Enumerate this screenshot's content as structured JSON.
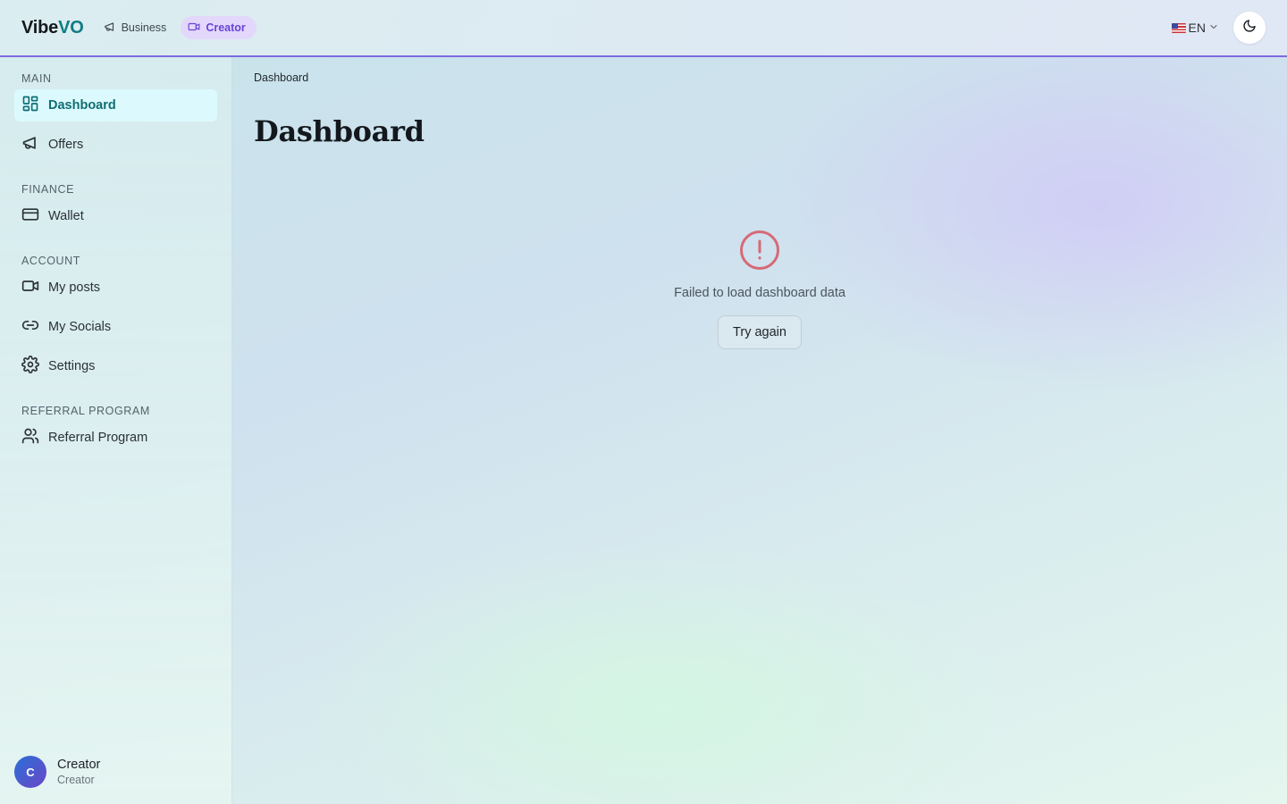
{
  "header": {
    "brand_primary": "Vibe",
    "brand_accent": "VO",
    "modes": [
      {
        "label": "Business",
        "icon": "megaphone-icon",
        "active": false
      },
      {
        "label": "Creator",
        "icon": "video-icon",
        "active": true
      }
    ],
    "language": "EN",
    "language_flag": "us-flag-icon",
    "theme_toggle_icon": "moon-icon"
  },
  "sidebar": {
    "sections": [
      {
        "label": "MAIN",
        "items": [
          {
            "label": "Dashboard",
            "icon": "dashboard-grid-icon",
            "active": true
          },
          {
            "label": "Offers",
            "icon": "megaphone-icon",
            "active": false
          }
        ]
      },
      {
        "label": "FINANCE",
        "items": [
          {
            "label": "Wallet",
            "icon": "credit-card-icon",
            "active": false
          }
        ]
      },
      {
        "label": "ACCOUNT",
        "items": [
          {
            "label": "My posts",
            "icon": "video-icon",
            "active": false
          },
          {
            "label": "My Socials",
            "icon": "link-icon",
            "active": false
          },
          {
            "label": "Settings",
            "icon": "gear-icon",
            "active": false
          }
        ]
      },
      {
        "label": "REFERRAL PROGRAM",
        "items": [
          {
            "label": "Referral Program",
            "icon": "users-icon",
            "active": false
          }
        ]
      }
    ],
    "user": {
      "initial": "C",
      "name": "Creator",
      "role": "Creator"
    }
  },
  "main": {
    "breadcrumb": "Dashboard",
    "title": "Dashboard",
    "error": {
      "icon": "alert-circle-icon",
      "message": "Failed to load dashboard data",
      "retry_label": "Try again"
    }
  },
  "colors": {
    "accent_teal": "#0f7c84",
    "accent_purple": "#6a43d6",
    "header_border": "#7c6be0",
    "active_nav_bg": "#dcfafd",
    "error_red": "#d66a76"
  }
}
